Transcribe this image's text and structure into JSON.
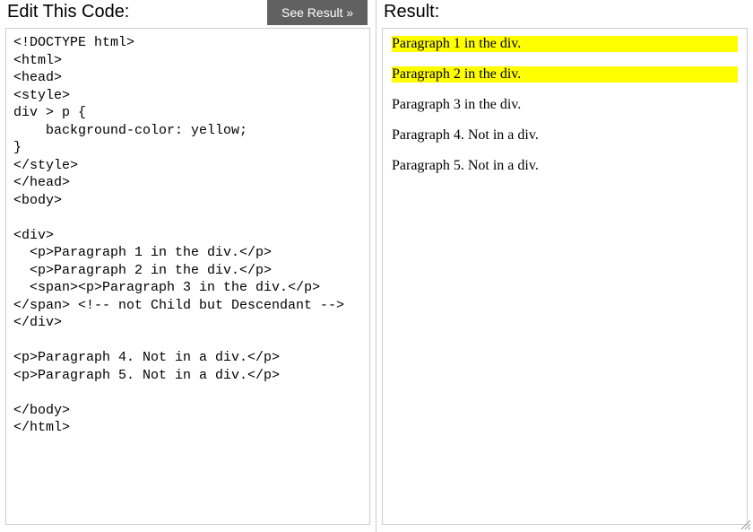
{
  "editor": {
    "title": "Edit This Code:",
    "code": "<!DOCTYPE html>\n<html>\n<head>\n<style>\ndiv > p {\n    background-color: yellow;\n}\n</style>\n</head>\n<body>\n\n<div>\n  <p>Paragraph 1 in the div.</p>\n  <p>Paragraph 2 in the div.</p>\n  <span><p>Paragraph 3 in the div.</p></span> <!-- not Child but Descendant -->\n</div>\n\n<p>Paragraph 4. Not in a div.</p>\n<p>Paragraph 5. Not in a div.</p>\n\n</body>\n</html>"
  },
  "button": {
    "see_result_label": "See Result »"
  },
  "result": {
    "title": "Result:",
    "paragraphs": [
      {
        "text": "Paragraph 1 in the div.",
        "highlighted": true
      },
      {
        "text": "Paragraph 2 in the div.",
        "highlighted": true
      },
      {
        "text": "Paragraph 3 in the div.",
        "highlighted": false
      },
      {
        "text": "Paragraph 4. Not in a div.",
        "highlighted": false
      },
      {
        "text": "Paragraph 5. Not in a div.",
        "highlighted": false
      }
    ]
  }
}
